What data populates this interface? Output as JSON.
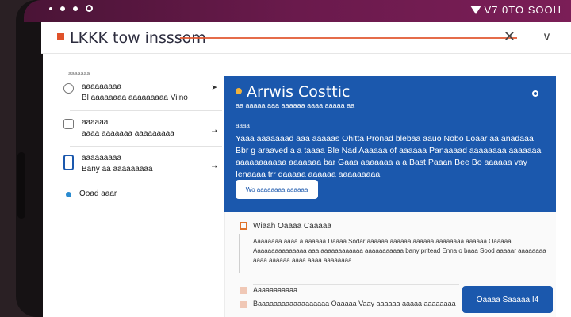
{
  "status_bar": {
    "right_text": "V7 0TO SOOH"
  },
  "app_bar": {
    "title": "LKKK tow insssom"
  },
  "sidebar": {
    "heading": "aaaaaaa",
    "items": [
      {
        "icon": "circle-icon",
        "lines": [
          "aaaaaaaaa",
          "Bl  aaaaaaaa aaaaaaaaa Viino"
        ]
      },
      {
        "icon": "document-icon",
        "lines": [
          "aaaaaa",
          "aaaa aaaaaaa aaaaaaaaa"
        ]
      },
      {
        "icon": "tablet-icon",
        "lines": [
          "aaaaaaaaa",
          "Bany aa aaaaaaaaa"
        ]
      },
      {
        "icon": "dot-icon",
        "lines": [
          "Ooad aaar"
        ]
      }
    ]
  },
  "hero": {
    "title": "Arrwis Costtic",
    "subtitle": "aa aaaaa aaa aaaaaa aaaa aaaaa aa",
    "meta": "aaaa",
    "body": "Yaaa aaaaaaad aaa aaaaas Ohitta Pronad blebaa aauo Nobo Loaar aa anadaaa Bbr g araaved a a taaaa Ble Nad Aaaaaa of aaaaaa Panaaaad aaaaaaaa aaaaaaa aaaaaaaaaaa aaaaaaa bar Gaaa aaaaaaa a a Bast Paaan Bee Bo aaaaaa vay Ienaaaa trr daaaaa aaaaaa aaaaaaaaa",
    "button_label": "Wo aaaaaaaa aaaaaa"
  },
  "panel": {
    "title": "Wiaah Oaaaa Caaaaa",
    "text": "Aaaaaaaa aaaa a aaaaaa Daaaa Sodar aaaaaa aaaaaa aaaaaa aaaaaaaa aaaaaa Oaaaaa Aaaaaaaaaaaaaaa aaa aaaaaaaaaaaa aaaaaaaaaaa  bany pritead Enna o baaa Sood aaaaar aaaaaaaa aaaa aaaaaa aaaa aaaa aaaaaaaa",
    "rows": [
      "Aaaaaaaaaaa",
      "Baaaaaaaaaaaaaaaaaa Oaaaaa Vaay aaaaaa aaaaa aaaaaaaa"
    ],
    "cta_label": "Oaaaa Saaaaa I4"
  }
}
